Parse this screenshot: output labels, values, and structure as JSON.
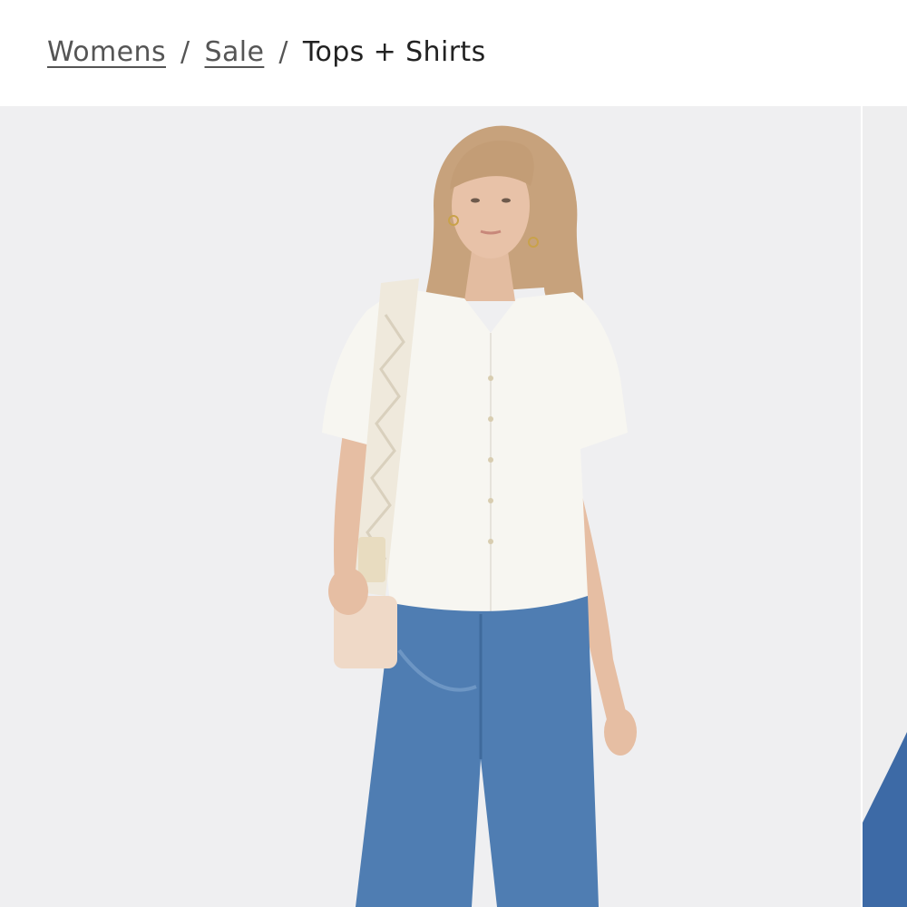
{
  "breadcrumb": {
    "items": [
      {
        "label": "Womens",
        "link": true
      },
      {
        "label": "Sale",
        "link": true
      },
      {
        "label": "Tops + Shirts",
        "link": false
      }
    ],
    "separator": "/"
  },
  "gallery": {
    "main_image": {
      "alt": ""
    },
    "colors": {
      "background": "#efeff1",
      "shirt": "#f7f6f1",
      "jeans": "#4f7db2",
      "hair": "#c7a27c",
      "skin": "#e8c2a8",
      "strap": "#efe9dc",
      "bag": "#efd9c7"
    }
  }
}
